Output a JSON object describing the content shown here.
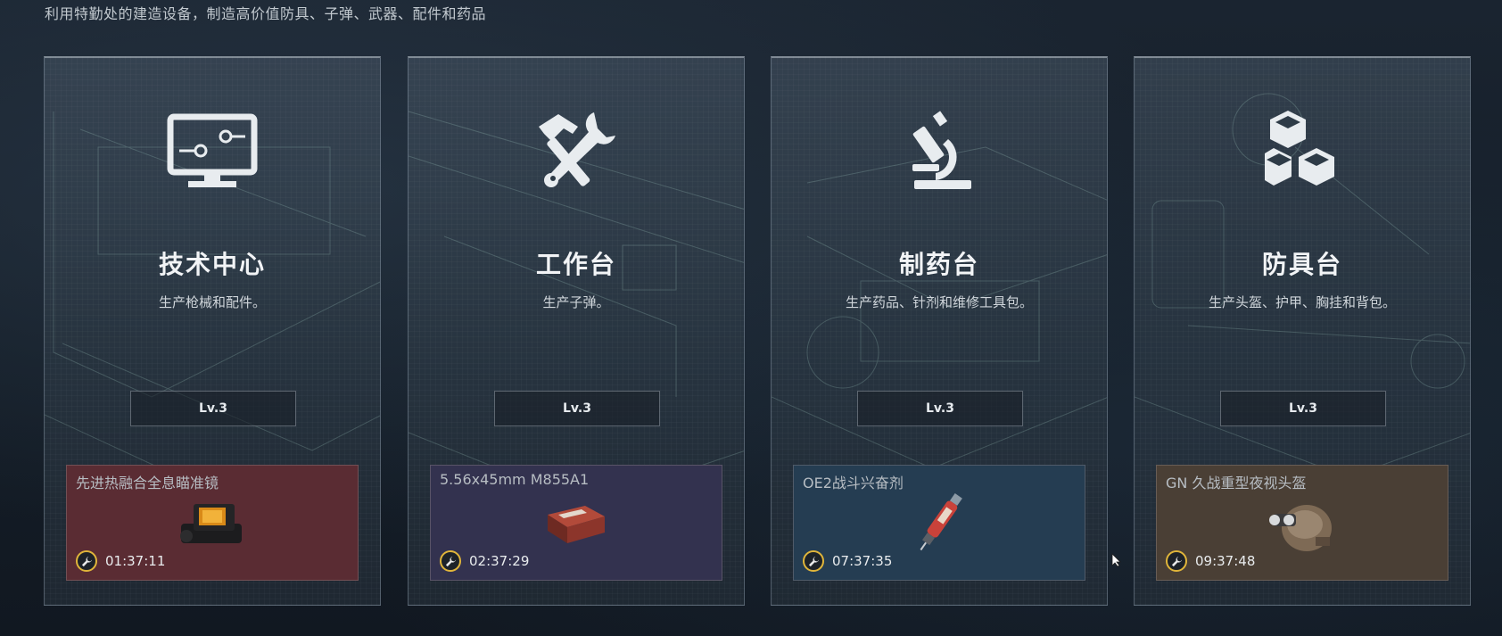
{
  "header": {
    "subtitle": "利用特勤处的建造设备，制造高价值防具、子弹、武器、配件和药品"
  },
  "colors": {
    "timer_ring": "#e0b53a",
    "prod_red": "#5a2c33",
    "prod_purple": "#33324f",
    "prod_blue": "#253d52",
    "prod_brown": "#4a3f35"
  },
  "cards": [
    {
      "icon": "computer-monitor-icon",
      "title": "技术中心",
      "desc": "生产枪械和配件。",
      "level": "Lv.3",
      "production": {
        "item_name": "先进热融合全息瞄准镜",
        "item_icon": "holographic-sight-icon",
        "timer": "01:37:11"
      }
    },
    {
      "icon": "hammer-wrench-icon",
      "title": "工作台",
      "desc": "生产子弹。",
      "level": "Lv.3",
      "production": {
        "item_name": "5.56x45mm M855A1",
        "item_icon": "ammo-box-icon",
        "timer": "02:37:29"
      }
    },
    {
      "icon": "microscope-icon",
      "title": "制药台",
      "desc": "生产药品、针剂和维修工具包。",
      "level": "Lv.3",
      "production": {
        "item_name": "OE2战斗兴奋剂",
        "item_icon": "injector-icon",
        "timer": "07:37:35"
      }
    },
    {
      "icon": "cubes-icon",
      "title": "防具台",
      "desc": "生产头盔、护甲、胸挂和背包。",
      "level": "Lv.3",
      "production": {
        "item_name": "GN 久战重型夜视头盔",
        "item_icon": "night-vision-helmet-icon",
        "timer": "09:37:48"
      }
    }
  ]
}
